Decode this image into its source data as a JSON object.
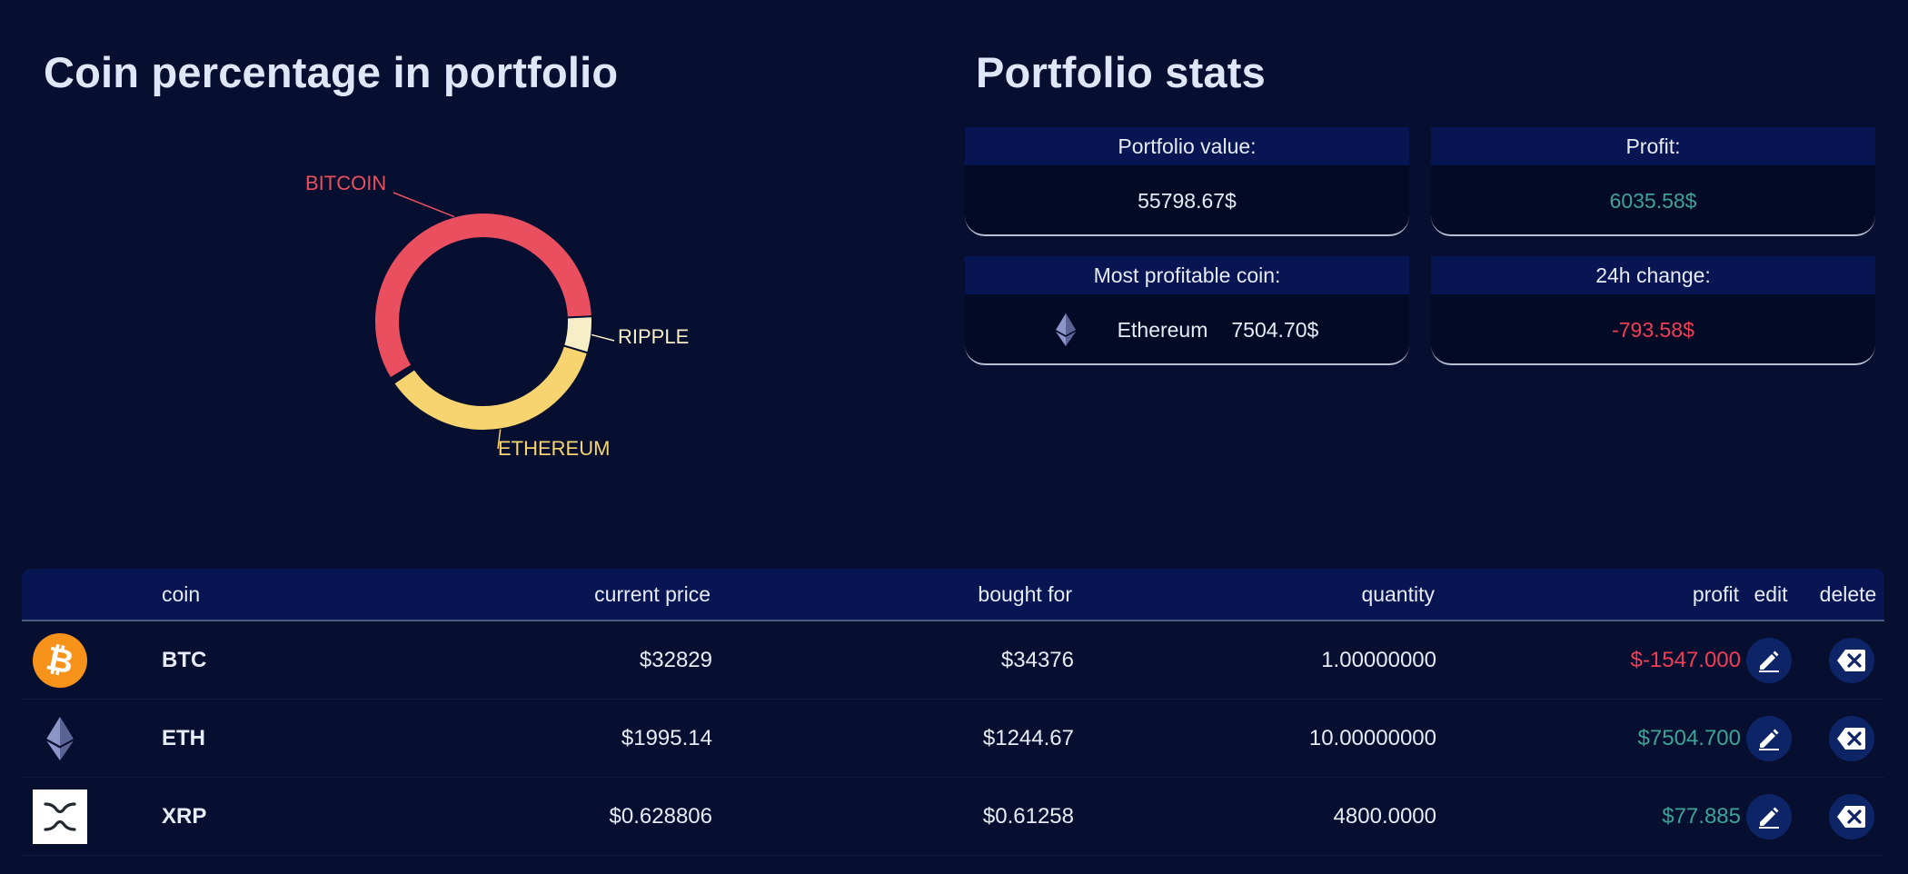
{
  "left_title": "Coin percentage in portfolio",
  "right_title": "Portfolio stats",
  "chart_data": {
    "type": "pie",
    "style": "donut",
    "slices": [
      {
        "label": "BITCOIN",
        "value": 58.8,
        "color": "#e94f5e"
      },
      {
        "label": "ETHEREUM",
        "value": 35.8,
        "color": "#f7d46f"
      },
      {
        "label": "RIPPLE",
        "value": 5.4,
        "color": "#f5eec6"
      }
    ]
  },
  "stats": {
    "portfolio_value": {
      "label": "Portfolio value:",
      "value": "55798.67$"
    },
    "profit": {
      "label": "Profit:",
      "value": "6035.58$"
    },
    "most_profitable": {
      "label": "Most profitable coin:",
      "coin": "Ethereum",
      "value": "7504.70$"
    },
    "change_24h": {
      "label": "24h change:",
      "value": "-793.58$"
    }
  },
  "table": {
    "headers": {
      "coin": "coin",
      "current_price": "current price",
      "bought_for": "bought for",
      "quantity": "quantity",
      "profit": "profit",
      "edit": "edit",
      "delete": "delete"
    },
    "rows": [
      {
        "icon": "bitcoin-icon",
        "coin": "BTC",
        "current_price": "$32829",
        "bought_for": "$34376",
        "quantity": "1.00000000",
        "profit": "$-1547.000",
        "profit_sign": "neg"
      },
      {
        "icon": "ethereum-icon",
        "coin": "ETH",
        "current_price": "$1995.14",
        "bought_for": "$1244.67",
        "quantity": "10.00000000",
        "profit": "$7504.700",
        "profit_sign": "pos"
      },
      {
        "icon": "ripple-icon",
        "coin": "XRP",
        "current_price": "$0.628806",
        "bought_for": "$0.61258",
        "quantity": "4800.0000",
        "profit": "$77.885",
        "profit_sign": "pos"
      }
    ]
  },
  "colors": {
    "background": "#060f2f",
    "positive": "#3ea396",
    "negative": "#f23d56"
  }
}
